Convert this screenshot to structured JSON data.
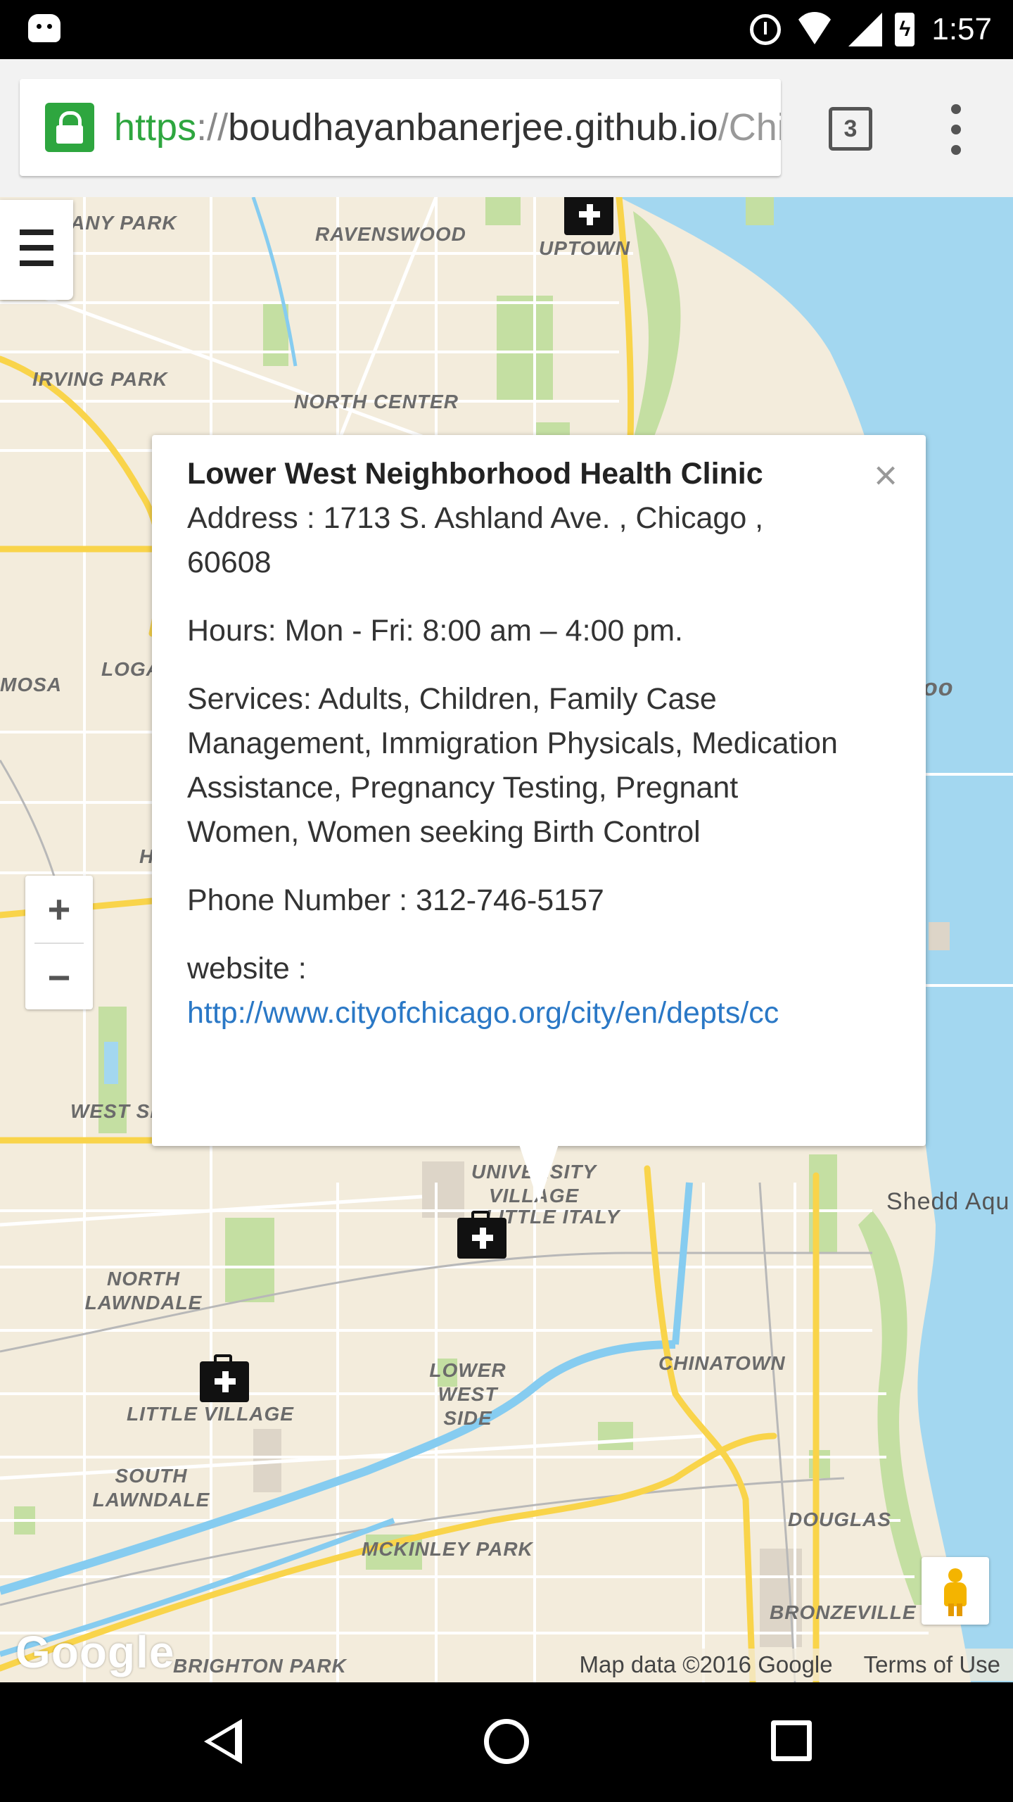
{
  "status_bar": {
    "time": "1:57"
  },
  "browser": {
    "url_scheme": "https",
    "url_sep": "://",
    "url_host": "boudhayanbanerjee.github.io",
    "url_path": "/Chi",
    "tab_count": "3"
  },
  "map": {
    "labels": {
      "any_park": "ANY PARK",
      "ravenswood": "RAVENSWOOD",
      "uptown": "UPTOWN",
      "irving_park": "IRVING PARK",
      "north_center": "NORTH CENTER",
      "mosa": "MOSA",
      "loga": "LOGA",
      "oo": "oo",
      "west_si": "WEST SI",
      "h": "H",
      "university_village": "UNIVERSITY VILLAGE",
      "little_italy": "LITTLE ITALY",
      "shedd": "Shedd Aqu",
      "north_lawndale": "NORTH LAWNDALE",
      "little_village": "LITTLE VILLAGE",
      "lower_west_side": "LOWER WEST SIDE",
      "chinatown": "CHINATOWN",
      "south_lawndale": "SOUTH LAWNDALE",
      "douglas": "DOUGLAS",
      "mckinley_park": "MCKINLEY PARK",
      "bronzeville": "BRONZEVILLE",
      "brighton_park": "BRIGHTON PARK"
    },
    "zoom_in": "+",
    "zoom_out": "−",
    "google": "Google",
    "map_data": "Map data ©2016 Google",
    "terms": "Terms of Use"
  },
  "popup": {
    "title": "Lower West Neighborhood Health Clinic",
    "address": "Address : 1713 S. Ashland Ave. , Chicago , 60608",
    "hours": "Hours: Mon - Fri: 8:00 am – 4:00 pm.",
    "services": "Services: Adults, Children, Family Case Management, Immigration Physicals, Medication Assistance, Pregnancy Testing, Pregnant Women, Women seeking Birth Control",
    "phone": "Phone Number : 312-746-5157",
    "website_label": "website :",
    "website_url": "http://www.cityofchicago.org/city/en/depts/cc",
    "close": "×"
  },
  "colors": {
    "map_land": "#f3ecdc",
    "water": "#a3d7f0",
    "park": "#c4dfa2",
    "highway": "#f9d44a",
    "road": "#ffffff",
    "river": "#86ccf0",
    "lock_green": "#2ea63f",
    "link_blue": "#2a78c6"
  }
}
